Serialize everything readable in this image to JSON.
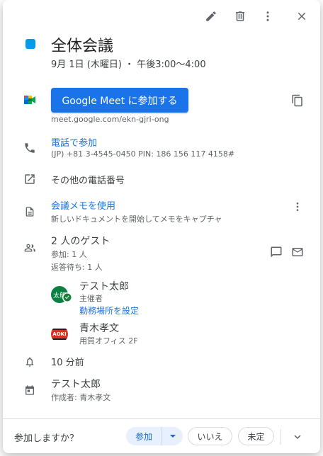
{
  "header": {
    "title": "全体会議",
    "datetime": "9月 1日 (木曜日) ・ 午後3:00～4:00",
    "color": "#039be5"
  },
  "toolbar": {
    "edit_icon": "pencil-icon",
    "delete_icon": "trash-icon",
    "more_icon": "more-vert-icon",
    "close_icon": "close-icon"
  },
  "meet": {
    "button_label": "Google Meet に参加する",
    "link": "meet.google.com/ekn-gjri-ong"
  },
  "phone": {
    "label": "電話で参加",
    "detail": "(JP) +81 3-4545-0450 PIN: 186 156 117 4158#"
  },
  "other_numbers": {
    "label": "その他の電話番号"
  },
  "notes": {
    "label": "会議メモを使用",
    "detail": "新しいドキュメントを開始してメモをキャプチャ"
  },
  "guests": {
    "title": "2 人のゲスト",
    "attending": "参加: 1 人",
    "awaiting": "返答待ち: 1 人",
    "list": [
      {
        "name": "テスト太郎",
        "avatar_text": "太郎",
        "role": "主催者",
        "action": "勤務場所を設定"
      },
      {
        "name": "青木孝文",
        "avatar_text": "AOKI",
        "role": "用賀オフィス 2F"
      }
    ]
  },
  "reminder": {
    "label": "10 分前"
  },
  "calendar": {
    "name": "テスト太郎",
    "creator": "作成者: 青木孝文"
  },
  "rsvp": {
    "question": "参加しますか？",
    "yes": "参加",
    "no": "いいえ",
    "maybe": "未定"
  }
}
